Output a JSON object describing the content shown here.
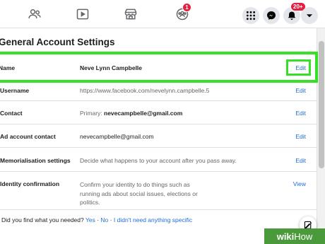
{
  "topbar": {
    "icons": [
      "friends-icon",
      "watch-icon",
      "marketplace-icon",
      "groups-icon"
    ],
    "groups_badge": "1",
    "notifications_badge": "20+"
  },
  "settings": {
    "title": "General Account Settings",
    "rows": [
      {
        "label": "Name",
        "value": "Neve Lynn Campbelle",
        "action": "Edit"
      },
      {
        "label": "Username",
        "value": "https://www.facebook.com/nevelynn.campbelle.5",
        "action": "Edit"
      },
      {
        "label": "Contact",
        "value_prefix": "Primary: ",
        "value": "nevecampbelle@gmail.com",
        "action": "Edit"
      },
      {
        "label": "Ad account contact",
        "value": "nevecampbelle@gmail.com",
        "action": "Edit"
      },
      {
        "label": "Memorialisation settings",
        "value": "Decide what happens to your account after you pass away.",
        "action": "Edit"
      },
      {
        "label": "Identity confirmation",
        "value_lines": [
          "Confirm your identity to do things such as",
          "running ads about social issues, elections or",
          "politics."
        ],
        "action": "View"
      }
    ]
  },
  "footer": {
    "question": "Did you find what you needed?",
    "yes": "Yes",
    "sep1": "·",
    "no": "No",
    "sep2": "·",
    "not_specific": "I didn't need anything specific"
  },
  "watermark": {
    "prefix": "wiki",
    "suffix": "How"
  },
  "colors": {
    "highlight": "#35e027",
    "link": "#216fdb"
  }
}
